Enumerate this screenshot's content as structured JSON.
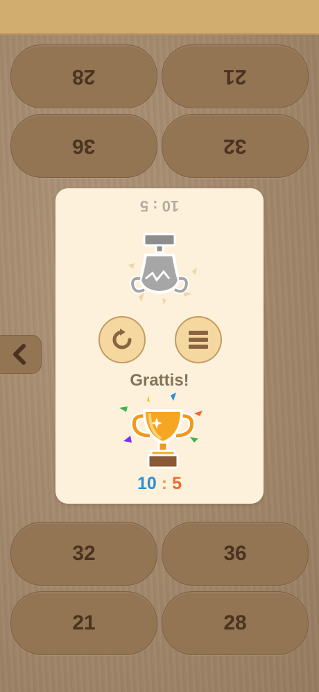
{
  "top_pills": [
    {
      "label": "28"
    },
    {
      "label": "21"
    },
    {
      "label": "36"
    },
    {
      "label": "32"
    }
  ],
  "bottom_pills": [
    {
      "label": "32"
    },
    {
      "label": "36"
    },
    {
      "label": "21"
    },
    {
      "label": "28"
    }
  ],
  "result_card": {
    "opponent_score": "10 : 5",
    "message": "Grattis!",
    "score_left": "10",
    "score_separator": ":",
    "score_right": "5",
    "restart_icon": "restart-icon",
    "menu_icon": "menu-icon"
  },
  "colors": {
    "top_bar": "#d2ad70",
    "pill": "#937453",
    "card": "#fdf1dc",
    "score_left": "#2a8fd6",
    "score_right": "#ef6a2a"
  }
}
